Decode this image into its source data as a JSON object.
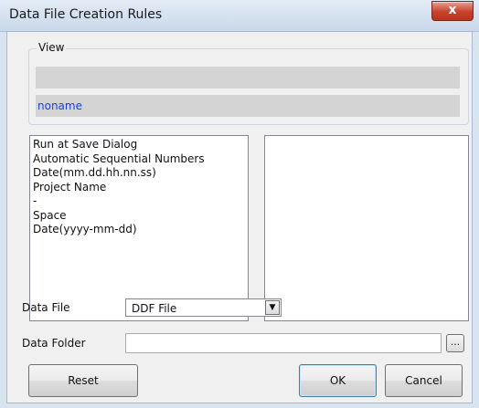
{
  "window": {
    "title": "Data File Creation Rules",
    "close_glyph": "x"
  },
  "view_group": {
    "label": "View",
    "preview_line1": "",
    "preview_line2": "noname"
  },
  "available_items": [
    "Run at Save Dialog",
    "Automatic Sequential Numbers",
    "Date(mm.dd.hh.nn.ss)",
    "Project Name",
    "-",
    "Space",
    "Date(yyyy-mm-dd)"
  ],
  "selected_items": [],
  "data_file": {
    "label": "Data File",
    "value": "DDF File",
    "arrow": "▼"
  },
  "data_folder": {
    "label": "Data Folder",
    "value": "",
    "browse_label": "..."
  },
  "buttons": {
    "reset": "Reset",
    "ok": "OK",
    "cancel": "Cancel"
  },
  "colors": {
    "title_bar": "#c9d8ea",
    "close_button": "#c7412b",
    "noname_text": "#1b3fd6"
  }
}
